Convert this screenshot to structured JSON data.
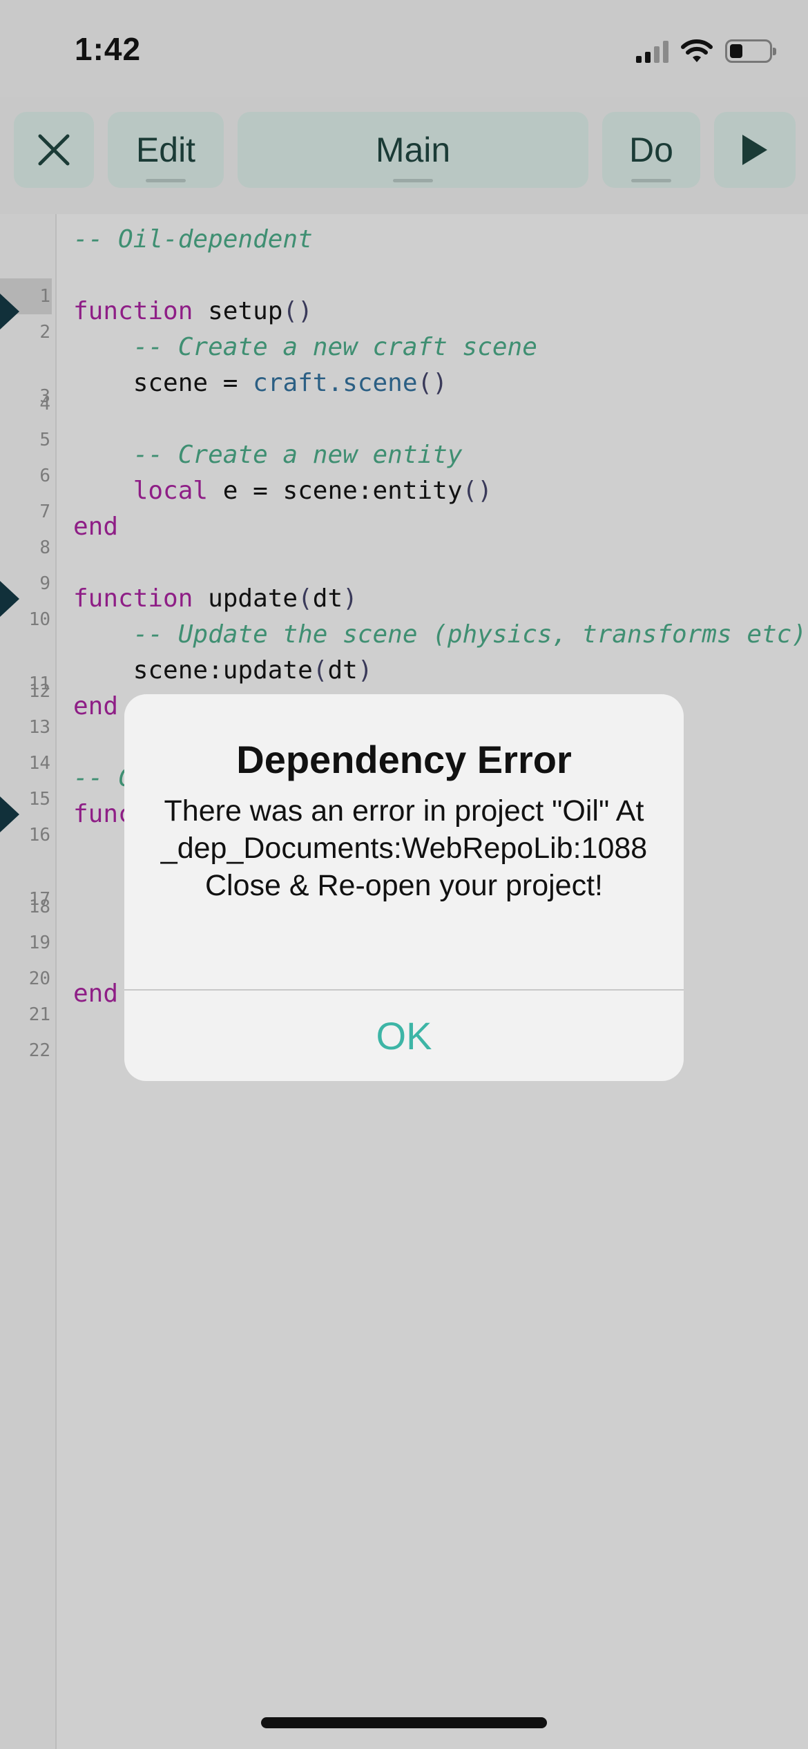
{
  "status_bar": {
    "time": "1:42"
  },
  "toolbar": {
    "edit_label": "Edit",
    "main_label": "Main",
    "do_label": "Do"
  },
  "editor": {
    "line_numbers": [
      "1",
      "2",
      "3",
      "4",
      "5",
      "6",
      "7",
      "8",
      "9",
      "10",
      "11",
      "12",
      "13",
      "14",
      "15",
      "16",
      "17",
      "18",
      "19",
      "20",
      "21",
      "22"
    ],
    "lines": {
      "l1": "-- Oil-dependent",
      "l3_kw": "function",
      "l3_name": " setup",
      "l3_parens": "()",
      "l4": "    -- Create a new craft scene",
      "l5_a": "    scene = ",
      "l5_b": "craft.scene",
      "l5_c": "()",
      "l7": "    -- Create a new entity",
      "l8_kw": "    local",
      "l8_a": " e = scene:entity",
      "l8_b": "()",
      "l9": "end",
      "l11_kw": "function",
      "l11_name": " update",
      "l11_p1": "(",
      "l11_arg": "dt",
      "l11_p2": ")",
      "l12": "    -- Update the scene (physics, transforms etc)",
      "l13_a": "    scene:update",
      "l13_p1": "(",
      "l13_arg": "dt",
      "l13_p2": ")",
      "l14": "end",
      "l16": "-- C",
      "l17": "func",
      "l22": "end"
    }
  },
  "dialog": {
    "title": "Dependency Error",
    "message": "There was an error in project \"Oil\" At _dep_Documents:WebRepoLib:1088 Close & Re-open your project!",
    "ok_label": "OK"
  },
  "colors": {
    "accent": "#3db5a6",
    "keyword": "#8e1e86",
    "comment": "#3f8f72",
    "function": "#2b5f84"
  }
}
